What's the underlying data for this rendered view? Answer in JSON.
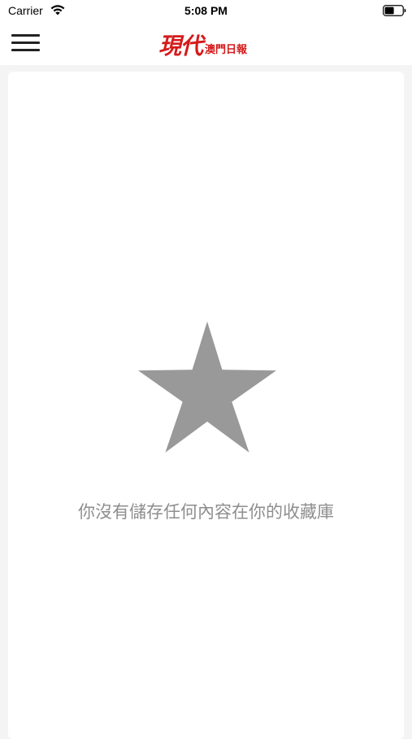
{
  "status_bar": {
    "carrier": "Carrier",
    "time": "5:08 PM",
    "wifi_icon": "wifi-icon",
    "battery_icon": "battery-icon"
  },
  "header": {
    "menu_icon": "hamburger-menu-icon",
    "logo_main": "現代",
    "logo_sub": "澳門日報",
    "logo_color": "#d51a1a"
  },
  "favorites": {
    "empty_icon": "star-icon",
    "empty_icon_color": "#999999",
    "empty_message": "你沒有儲存任何內容在你的收藏庫"
  },
  "colors": {
    "page_background": "#f4f4f4",
    "card_background": "#ffffff",
    "message_text": "#8e8e8e"
  }
}
